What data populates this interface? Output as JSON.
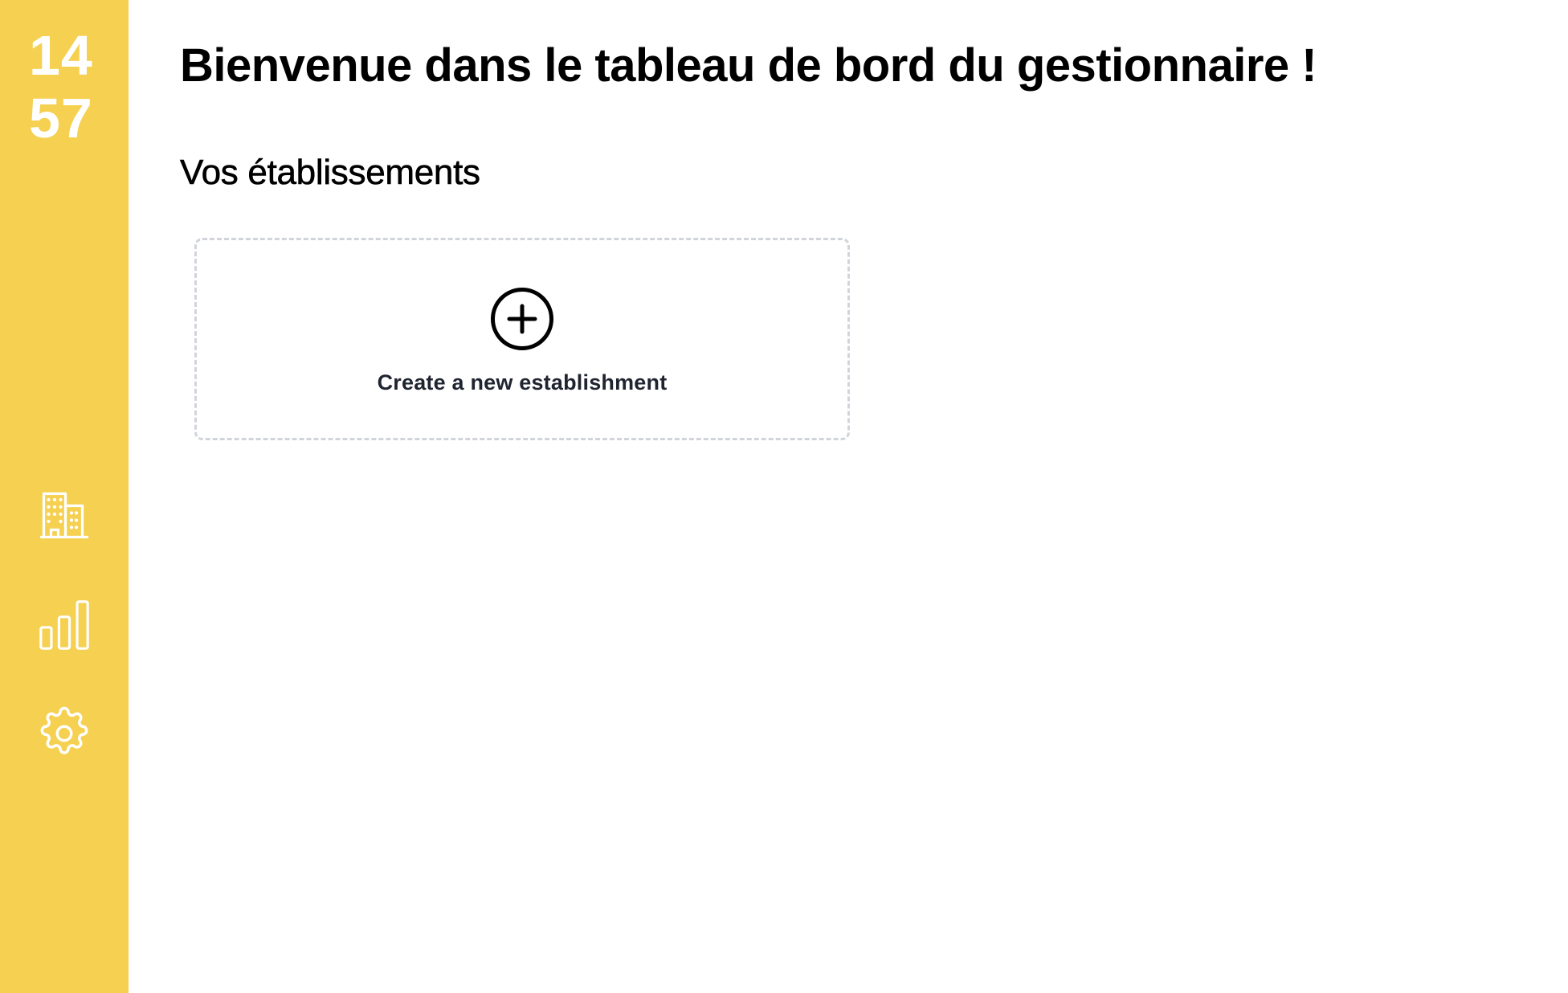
{
  "sidebar": {
    "logo": {
      "line1": "14",
      "line2": "57"
    },
    "nav": [
      {
        "icon": "building-icon",
        "label": ""
      },
      {
        "icon": "bar-chart-icon",
        "label": ""
      },
      {
        "icon": "gear-icon",
        "label": ""
      }
    ],
    "background_color": "#f6d050",
    "icon_color": "#ffffff"
  },
  "main": {
    "title": "Bienvenue dans le tableau de bord du gestionnaire !",
    "section_title": "Vos établissements",
    "create_card": {
      "icon": "plus-circle-icon",
      "label": "Create a new establishment",
      "border_color": "#d1d5db"
    }
  }
}
